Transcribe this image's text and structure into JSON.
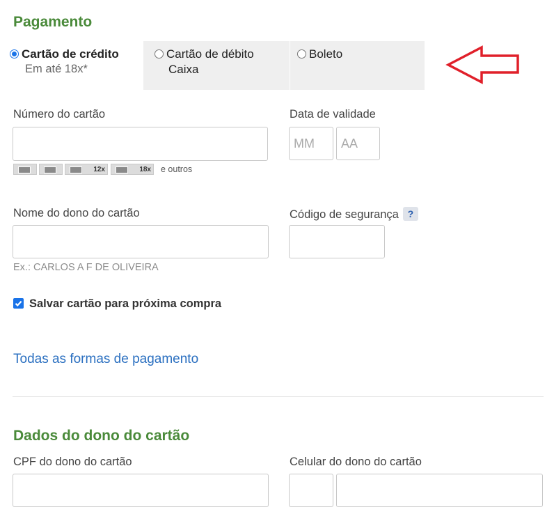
{
  "payment": {
    "title": "Pagamento",
    "tabs": [
      {
        "label": "Cartão de crédito",
        "sub": "Em até 18x*",
        "selected": true
      },
      {
        "label": "Cartão de débito",
        "sub": "Caixa",
        "selected": false
      },
      {
        "label": "Boleto",
        "sub": "",
        "selected": false
      }
    ]
  },
  "card_form": {
    "number_label": "Número do cartão",
    "number_value": "",
    "expiry_label": "Data de validade",
    "expiry_month_placeholder": "MM",
    "expiry_year_placeholder": "AA",
    "brands": [
      {
        "name": "mastercard",
        "installments": ""
      },
      {
        "name": "visa",
        "installments": ""
      },
      {
        "name": "amex",
        "installments": "12x"
      },
      {
        "name": "elo",
        "installments": "18x"
      }
    ],
    "brands_more": "e outros",
    "owner_label": "Nome do dono do cartão",
    "owner_value": "",
    "owner_hint": "Ex.: CARLOS A F DE OLIVEIRA",
    "cvv_label": "Código de segurança",
    "cvv_help": "?",
    "cvv_value": "",
    "save_card_label": "Salvar cartão para próxima compra",
    "save_card_checked": true,
    "all_payments_link": "Todas as formas de pagamento"
  },
  "owner_data": {
    "title": "Dados do dono do cartão",
    "cpf_label": "CPF do dono do cartão",
    "cpf_value": "",
    "phone_label": "Celular do dono do cartão",
    "phone_ddd_value": "",
    "phone_number_value": ""
  },
  "annotation": {
    "icon": "arrow-left-icon",
    "color": "#e0202a"
  }
}
